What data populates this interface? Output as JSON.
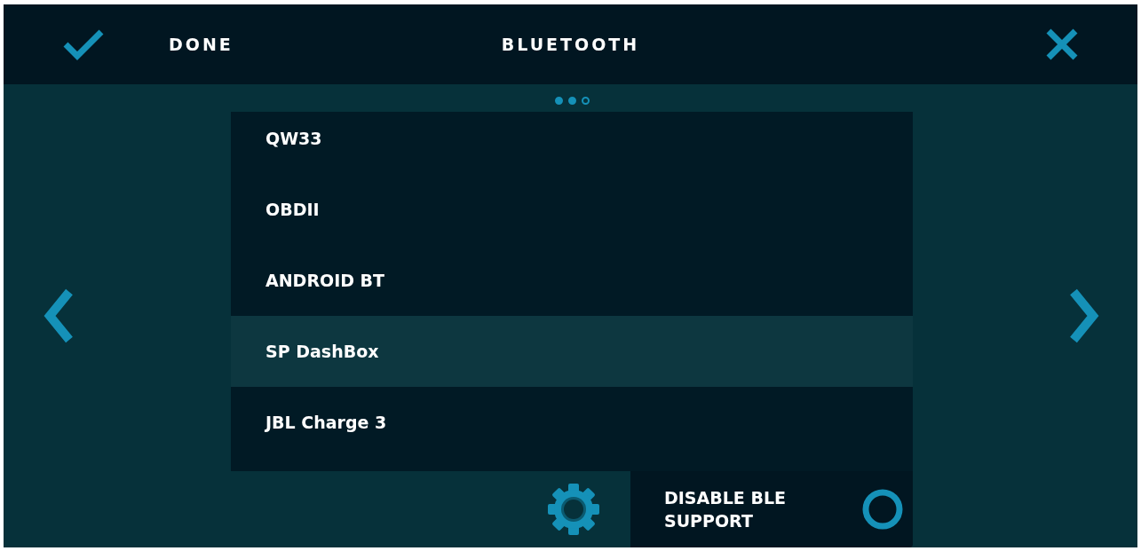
{
  "header": {
    "done_label": "DONE",
    "title": "BLUETOOTH"
  },
  "pager": [
    {
      "selected": false
    },
    {
      "selected": false
    },
    {
      "selected": true
    }
  ],
  "devices": [
    {
      "name": "QW33",
      "selected": false
    },
    {
      "name": "OBDII",
      "selected": false
    },
    {
      "name": "ANDROID BT",
      "selected": false
    },
    {
      "name": "SP DashBox",
      "selected": true
    },
    {
      "name": "JBL Charge 3",
      "selected": false
    }
  ],
  "ble": {
    "label": "DISABLE BLE SUPPORT",
    "on": false
  }
}
